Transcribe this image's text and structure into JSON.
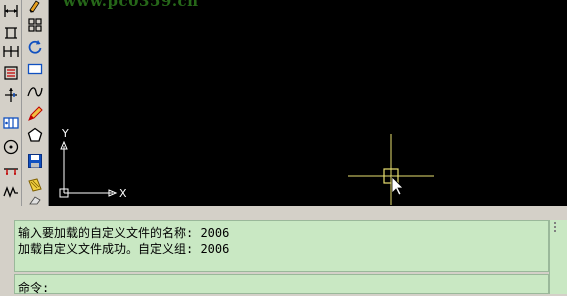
{
  "app": {
    "watermark": "www.pc0359.cn"
  },
  "toolbar_left": {
    "buttons": [
      {
        "name": "dimension-linear-icon"
      },
      {
        "name": "dimension-aligned-icon"
      },
      {
        "name": "dimension-continue-icon"
      },
      {
        "name": "dimension-baseline-icon"
      },
      {
        "name": "dimension-ordinate-icon"
      },
      {
        "name": "dimension-tolerance-icon"
      },
      {
        "name": "dimension-center-mark-icon"
      },
      {
        "name": "dimension-leader-icon"
      },
      {
        "name": "dimension-break-icon"
      }
    ]
  },
  "toolbar_draw": {
    "buttons": [
      {
        "name": "paint-icon"
      },
      {
        "name": "array-icon"
      },
      {
        "name": "rotate-icon"
      },
      {
        "name": "rectangle-icon"
      },
      {
        "name": "spline-icon"
      },
      {
        "name": "pencil-icon"
      },
      {
        "name": "polygon-icon"
      },
      {
        "name": "save-icon"
      },
      {
        "name": "hatch-icon"
      }
    ]
  },
  "canvas": {
    "ucs_x_label": "X",
    "ucs_y_label": "Y",
    "background": "#000000",
    "crosshair_color": "#e8e070"
  },
  "command": {
    "history": [
      "输入要加载的自定义文件的名称: 2006",
      "加载自定义文件成功。自定义组: 2006"
    ],
    "prompt": "命令:",
    "background": "#c9e8c3"
  }
}
